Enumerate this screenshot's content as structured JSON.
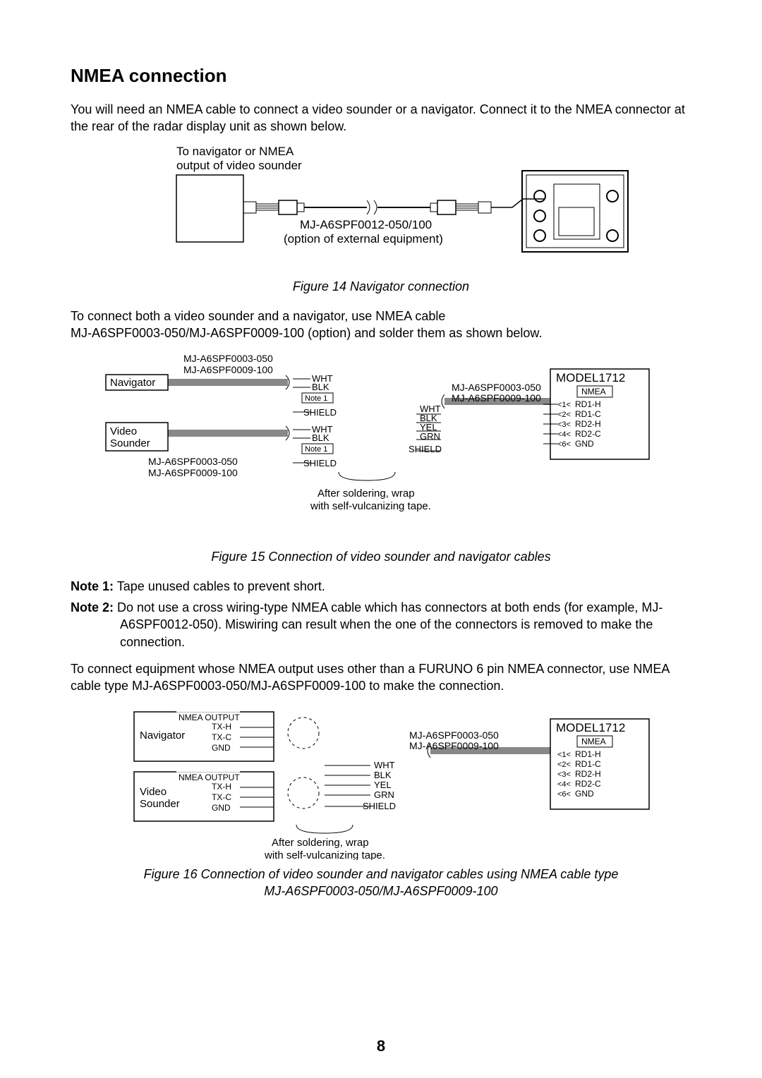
{
  "heading": "NMEA connection",
  "intro": "You will need an NMEA cable to connect a video sounder or a navigator. Connect it to the NMEA connector at the rear of the radar display unit as shown below.",
  "fig14": {
    "topLabel1": "To navigator or NMEA",
    "topLabel2": "output of video sounder",
    "cable1": "MJ-A6SPF0012-050/100",
    "cable2": "(option of external equipment)",
    "caption": "Figure 14 Navigator connection"
  },
  "para2a": "To connect both a video sounder and a navigator, use NMEA cable",
  "para2b": "MJ-A6SPF0003-050/MJ-A6SPF0009-100 (option) and solder them as shown below.",
  "fig15": {
    "mj003": "MJ-A6SPF0003-050",
    "mj009": "MJ-A6SPF0009-100",
    "navigator": "Navigator",
    "videoSounder1": "Video",
    "videoSounder2": "Sounder",
    "wht": "WHT",
    "blk": "BLK",
    "yel": "YEL",
    "grn": "GRN",
    "shield": "SHIELD",
    "note1": "Note 1",
    "model": "MODEL1712",
    "nmea": "NMEA",
    "pin1": "RD1-H",
    "pin2": "RD1-C",
    "pin3": "RD2-H",
    "pin4": "RD2-C",
    "pin6": "GND",
    "solder1": "After soldering, wrap",
    "solder2": "with self-vulcanizing tape.",
    "caption": "Figure 15 Connection of video sounder and navigator cables"
  },
  "note1": "Note 1: Tape unused cables to prevent short.",
  "note2": "Note 2: Do not use a cross wiring-type NMEA cable which has connectors at both ends (for example, MJ-A6SPF0012-050). Miswiring can result when the one of the connectors is removed to make the connection.",
  "para3": "To connect equipment whose NMEA output uses other than a FURUNO 6 pin NMEA connector, use NMEA cable type MJ-A6SPF0003-050/MJ-A6SPF0009-100 to make the connection.",
  "fig16": {
    "nmeaOut": "NMEA OUTPUT",
    "txh": "TX-H",
    "txc": "TX-C",
    "gnd": "GND",
    "caption1": "Figure 16 Connection of video sounder and navigator cables using NMEA cable type",
    "caption2": "MJ-A6SPF0003-050/MJ-A6SPF0009-100"
  },
  "pageNumber": "8"
}
